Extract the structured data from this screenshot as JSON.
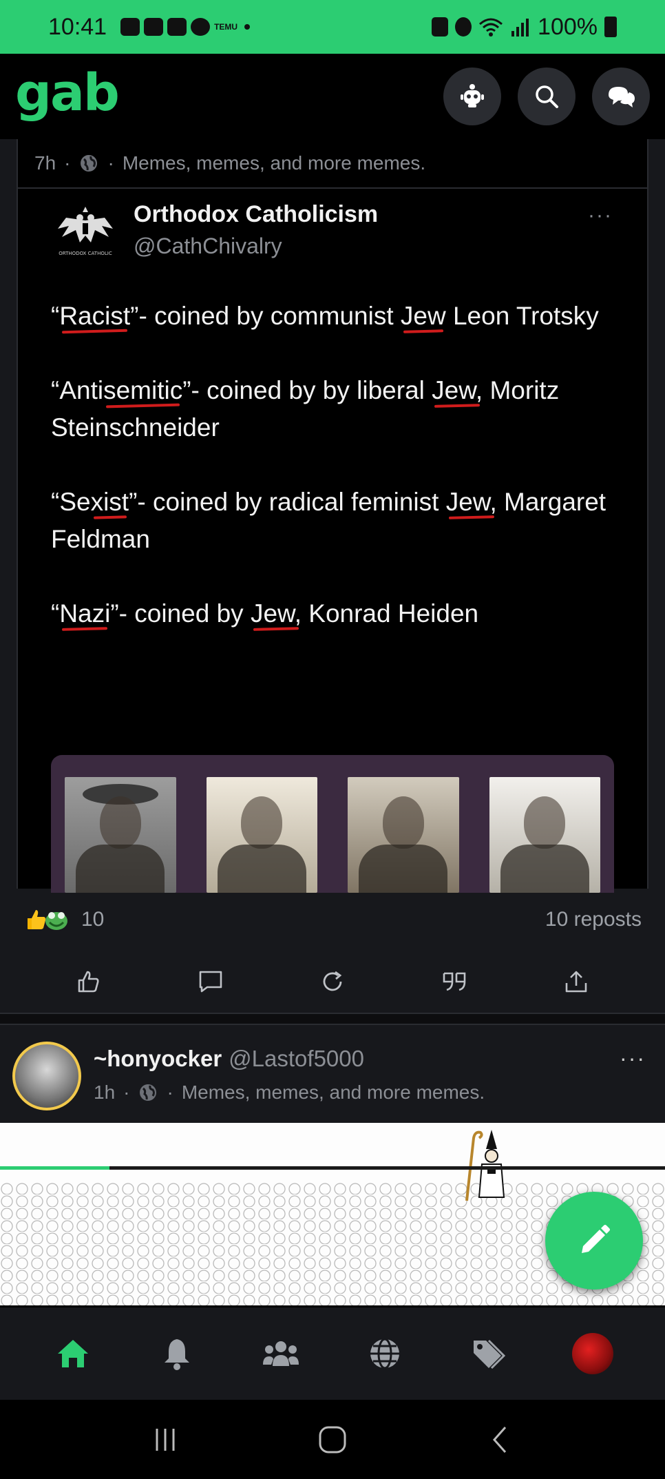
{
  "status_bar": {
    "time": "10:41",
    "battery": "100%",
    "icons": [
      "discord-icon",
      "discord-icon",
      "discord-icon",
      "whatsapp-icon",
      "temu-icon",
      "lock-icon",
      "alarm-icon",
      "wifi-icon",
      "signal-icon",
      "battery-icon"
    ],
    "temu_label": "TEMU"
  },
  "header": {
    "logo": "gab",
    "actions": [
      "robot-icon",
      "search-icon",
      "chat-icon"
    ]
  },
  "post1": {
    "time": "7h",
    "dot": "·",
    "group": "Memes, memes, and more memes.",
    "quoted": {
      "name": "Orthodox Catholicism",
      "handle": "@CathChivalry",
      "avatar_caption": "ORTHODOX CATHOLIC",
      "more": "···",
      "paragraphs": [
        {
          "a": "“",
          "u1": "Racist",
          "b": "”- coined by communist ",
          "u2": "Jew",
          "c": " Leon Trotsky"
        },
        {
          "a": "“Anti",
          "u1": "semitic",
          "b": "”- coined by by liberal ",
          "u2": "Jew,",
          "c": " Moritz Steinschneider"
        },
        {
          "a": "“Se",
          "u1": "xist",
          "b": "”- coined by radical feminist ",
          "u2": "Jew,",
          "c": " Margaret Feldman"
        },
        {
          "a": "“",
          "u1": "Nazi",
          "b": "”- coined by ",
          "u2": "Jew,",
          "c": " Konrad Heiden"
        }
      ]
    },
    "reaction_count": "10",
    "reposts": "10 reposts"
  },
  "post2": {
    "name": "~honyocker",
    "handle": "@Lastof5000",
    "time": "1h",
    "dot": "·",
    "group": "Memes, memes, and more memes.",
    "more": "···",
    "media_progress": 0.165
  },
  "bottom_nav": {
    "items": [
      "home-icon",
      "bell-icon",
      "groups-icon",
      "globe-icon",
      "tag-icon",
      "profile-avatar"
    ],
    "active": "home-icon"
  },
  "colors": {
    "brand": "#2ccd72",
    "underline": "#d01c1c",
    "background": "#000000",
    "surface": "#17181c"
  }
}
